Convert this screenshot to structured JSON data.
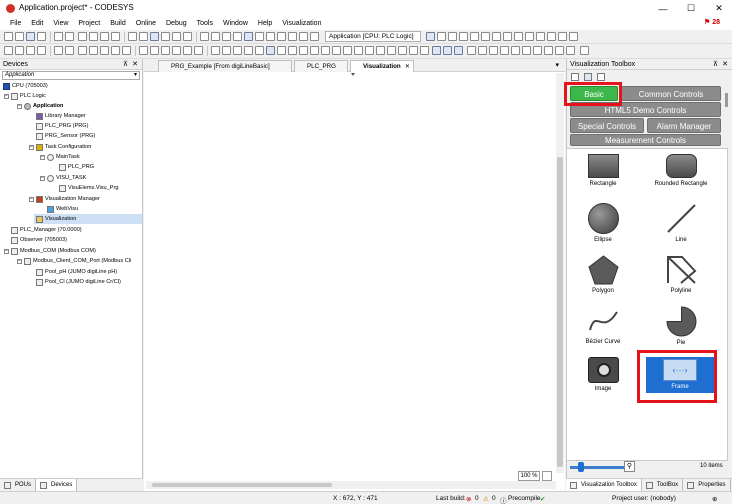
{
  "window": {
    "title": "Application.project* - CODESYS",
    "minimize": "—",
    "maximize": "☐",
    "close": "✕"
  },
  "menu": [
    "File",
    "Edit",
    "View",
    "Project",
    "Build",
    "Online",
    "Debug",
    "Tools",
    "Window",
    "Help",
    "Visualization"
  ],
  "notifications": {
    "count": "28"
  },
  "toolbar": {
    "app_selector": "Application [CPU: PLC Logic]"
  },
  "devices": {
    "title": "Devices",
    "pin": "⊼",
    "close": "✕",
    "dropdown": "Application",
    "items": [
      {
        "label": "CPU (705003)"
      },
      {
        "label": "PLC Logic"
      },
      {
        "label": "Application"
      },
      {
        "label": "Library Manager"
      },
      {
        "label": "PLC_PRG (PRG)"
      },
      {
        "label": "PRG_Sensor (PRG)"
      },
      {
        "label": "Task Configuration"
      },
      {
        "label": "MainTask"
      },
      {
        "label": "PLC_PRG"
      },
      {
        "label": "VISU_TASK"
      },
      {
        "label": "VisuElems.Visu_Prg"
      },
      {
        "label": "Visualization Manager"
      },
      {
        "label": "WebVisu"
      },
      {
        "label": "Visualization"
      },
      {
        "label": "PLC_Manager (70.0000)"
      },
      {
        "label": "Observer (705003)"
      },
      {
        "label": "Modbus_COM (Modbus COM)"
      },
      {
        "label": "Modbus_Client_COM_Port (Modbus Cli"
      },
      {
        "label": "Pool_pH (JUMO digiLine pH)"
      },
      {
        "label": "Pool_Cl (JUMO digiLine Cr/Cl)"
      }
    ],
    "bottom_tabs": [
      "POUs",
      "Devices"
    ]
  },
  "editor": {
    "tabs": [
      {
        "label": "PRG_Example [From digiLineBasic]"
      },
      {
        "label": "PLC_PRG"
      },
      {
        "label": "Visualization"
      }
    ],
    "zoom": "100 %"
  },
  "toolbox": {
    "title": "Visualization Toolbox",
    "pin": "⊼",
    "close": "✕",
    "categories": [
      "Basic",
      "Common Controls",
      "HTML5 Demo Controls",
      "Special Controls",
      "Alarm Manager",
      "Measurement Controls"
    ],
    "tools": [
      "Rectangle",
      "Rounded Rectangle",
      "Ellipse",
      "Line",
      "Polygon",
      "Polyline",
      "Bézier Curve",
      "Pie",
      "Image",
      "Frame"
    ],
    "count": "10 items",
    "bottom_tabs": [
      "Visualization Toolbox",
      "ToolBox",
      "Properties"
    ]
  },
  "status": {
    "coords": "X : 672, Y : 471",
    "last_build_label": "Last build:",
    "errors": "0",
    "warnings": "0",
    "precompile": "Precompile",
    "user": "Project user: (nobody)"
  },
  "colors": {
    "basic_green": "#3db64a",
    "category_gray": "#8c8c8c",
    "highlight_red": "#e5141b",
    "frame_blue": "#1f6fd1"
  }
}
